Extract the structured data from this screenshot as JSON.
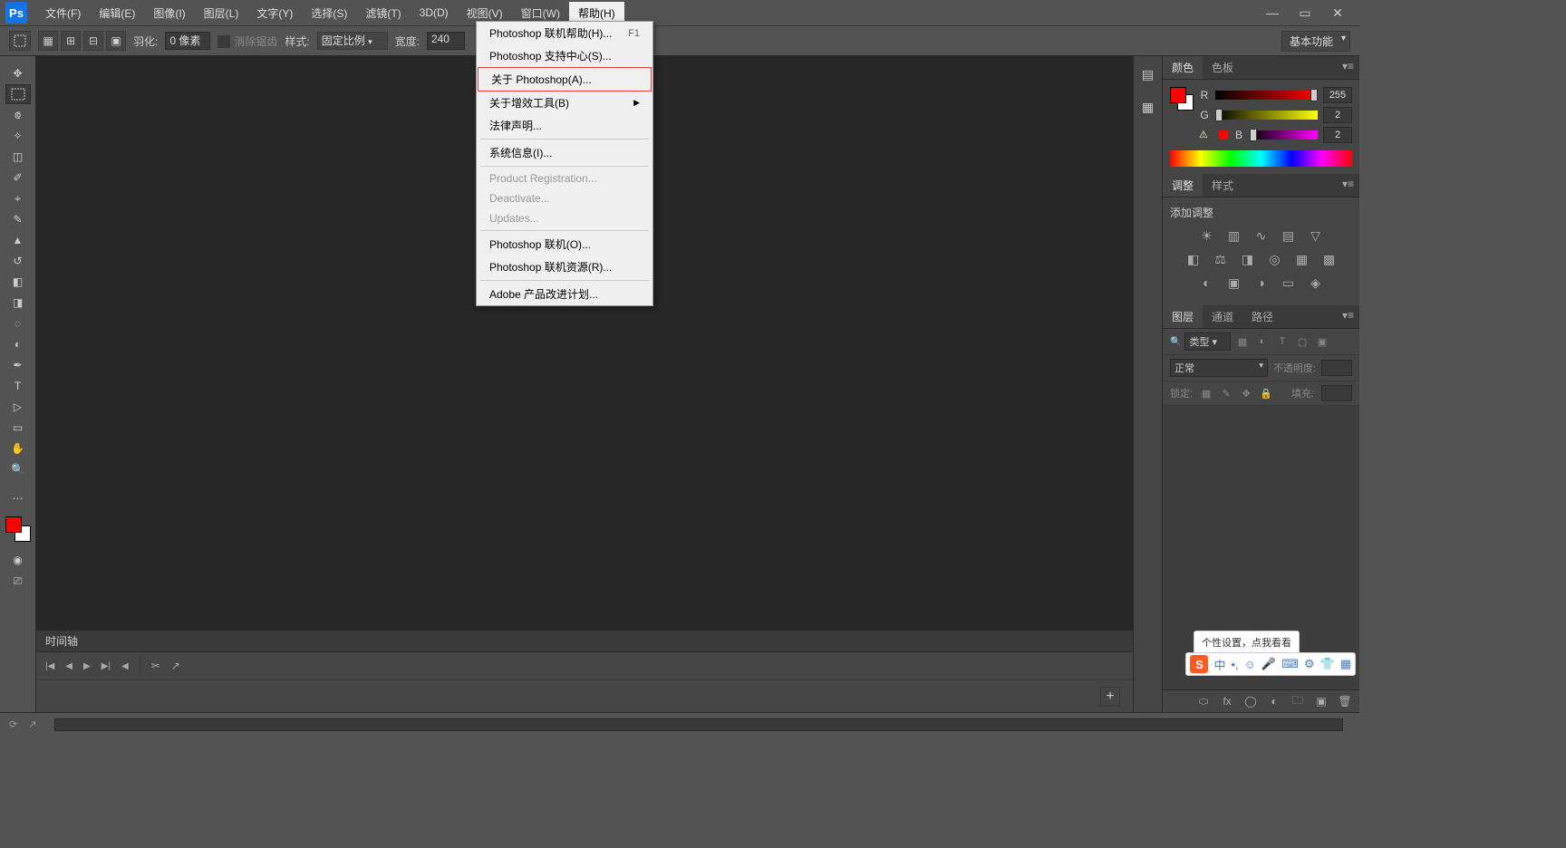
{
  "app": {
    "logo": "Ps"
  },
  "menubar": {
    "items": [
      {
        "label": "文件(F)"
      },
      {
        "label": "编辑(E)"
      },
      {
        "label": "图像(I)"
      },
      {
        "label": "图层(L)"
      },
      {
        "label": "文字(Y)"
      },
      {
        "label": "选择(S)"
      },
      {
        "label": "滤镜(T)"
      },
      {
        "label": "3D(D)"
      },
      {
        "label": "视图(V)"
      },
      {
        "label": "窗口(W)"
      },
      {
        "label": "帮助(H)"
      }
    ]
  },
  "optionsbar": {
    "feather_label": "羽化:",
    "feather_value": "0 像素",
    "antialias_label": "消除锯齿",
    "style_label": "样式:",
    "style_value": "固定比例",
    "width_label": "宽度:",
    "width_value": "240",
    "workspace": "基本功能"
  },
  "help_menu": {
    "items": [
      {
        "label": "Photoshop 联机帮助(H)...",
        "shortcut": "F1",
        "type": "item"
      },
      {
        "label": "Photoshop 支持中心(S)...",
        "type": "item"
      },
      {
        "label": "关于 Photoshop(A)...",
        "type": "highlight"
      },
      {
        "label": "关于增效工具(B)",
        "arrow": true,
        "type": "item"
      },
      {
        "label": "法律声明...",
        "type": "item"
      },
      {
        "type": "sep"
      },
      {
        "label": "系统信息(I)...",
        "type": "item"
      },
      {
        "type": "sep"
      },
      {
        "label": "Product Registration...",
        "type": "disabled"
      },
      {
        "label": "Deactivate...",
        "type": "disabled"
      },
      {
        "label": "Updates...",
        "type": "disabled"
      },
      {
        "type": "sep"
      },
      {
        "label": "Photoshop 联机(O)...",
        "type": "item"
      },
      {
        "label": "Photoshop 联机资源(R)...",
        "type": "item"
      },
      {
        "type": "sep"
      },
      {
        "label": "Adobe 产品改进计划...",
        "type": "item"
      }
    ]
  },
  "panels": {
    "color_tabs": {
      "t0": "颜色",
      "t1": "色板"
    },
    "color": {
      "r_lbl": "R",
      "r_val": "255",
      "g_lbl": "G",
      "g_val": "2",
      "b_lbl": "B",
      "b_val": "2"
    },
    "adjust_tabs": {
      "t0": "调整",
      "t1": "样式"
    },
    "adjust_title": "添加调整",
    "layers_tabs": {
      "t0": "图层",
      "t1": "通道",
      "t2": "路径"
    },
    "layers": {
      "kind_label": "类型",
      "blend": "正常",
      "opacity_label": "不透明度:",
      "lock_label": "锁定:",
      "fill_label": "填充:"
    }
  },
  "timeline": {
    "title": "时间轴"
  },
  "ime": {
    "bubble": "个性设置，点我看看",
    "lang": "中"
  }
}
